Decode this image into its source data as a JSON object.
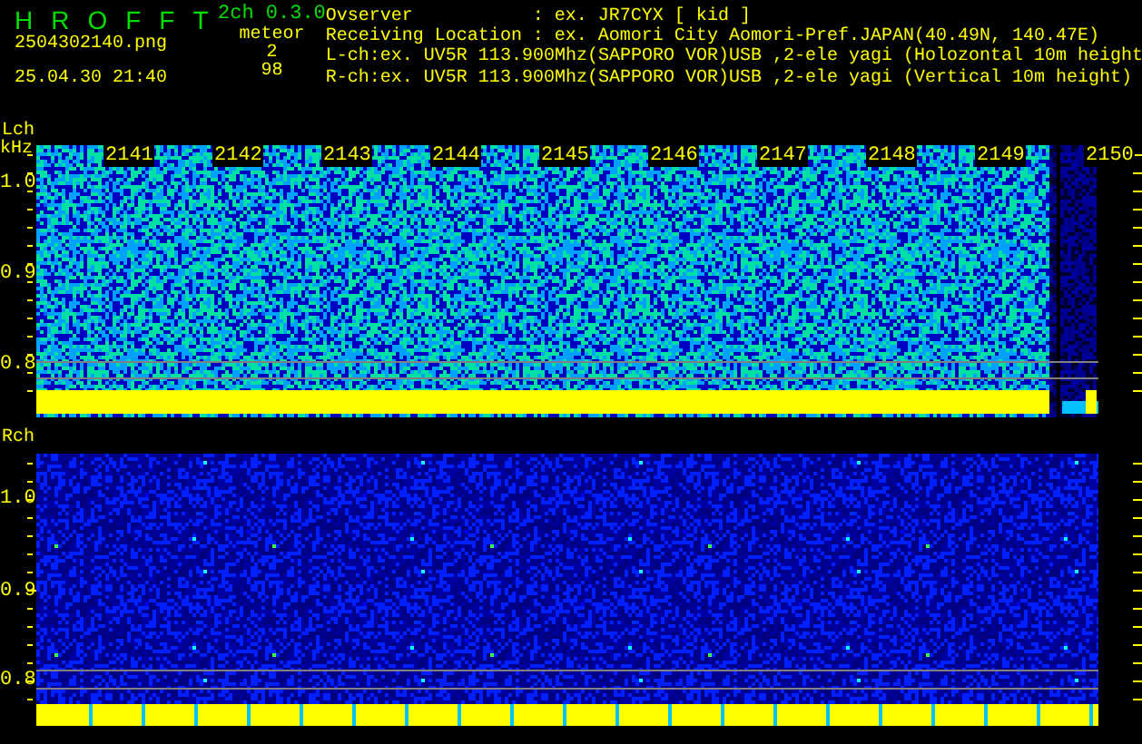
{
  "header": {
    "app_name": "HROFFT",
    "version": "2ch 0.3.0",
    "file_name": "2504302140.png",
    "timestamp": "25.04.30 21:40",
    "meteor_label": "meteor",
    "meteor_counts": [
      "2",
      "98"
    ],
    "fields": [
      {
        "label": "Ovserver",
        "value": ": ex. JR7CYX [ kid ]"
      },
      {
        "label": "Receiving Location",
        "value": ": ex. Aomori City Aomori-Pref.JAPAN(40.49N, 140.47E)"
      }
    ],
    "channel_lines": [
      "L-ch:ex. UV5R 113.900Mhz(SAPPORO VOR)USB ,2-ele yagi (Holozontal 10m height",
      "R-ch:ex. UV5R 113.900Mhz(SAPPORO VOR)USB ,2-ele yagi (Vertical 10m height)"
    ]
  },
  "panels": [
    {
      "channel": "Lch",
      "unit": "kHz",
      "time_labels": [
        "2141",
        "2142",
        "2143",
        "2144",
        "2145",
        "2146",
        "2147",
        "2148",
        "2149",
        "2150"
      ],
      "yticks": [
        "1.0",
        "0.9",
        "0.8"
      ]
    },
    {
      "channel": "Rch",
      "yticks": [
        "1.0",
        "0.9",
        "0.8"
      ]
    }
  ]
}
